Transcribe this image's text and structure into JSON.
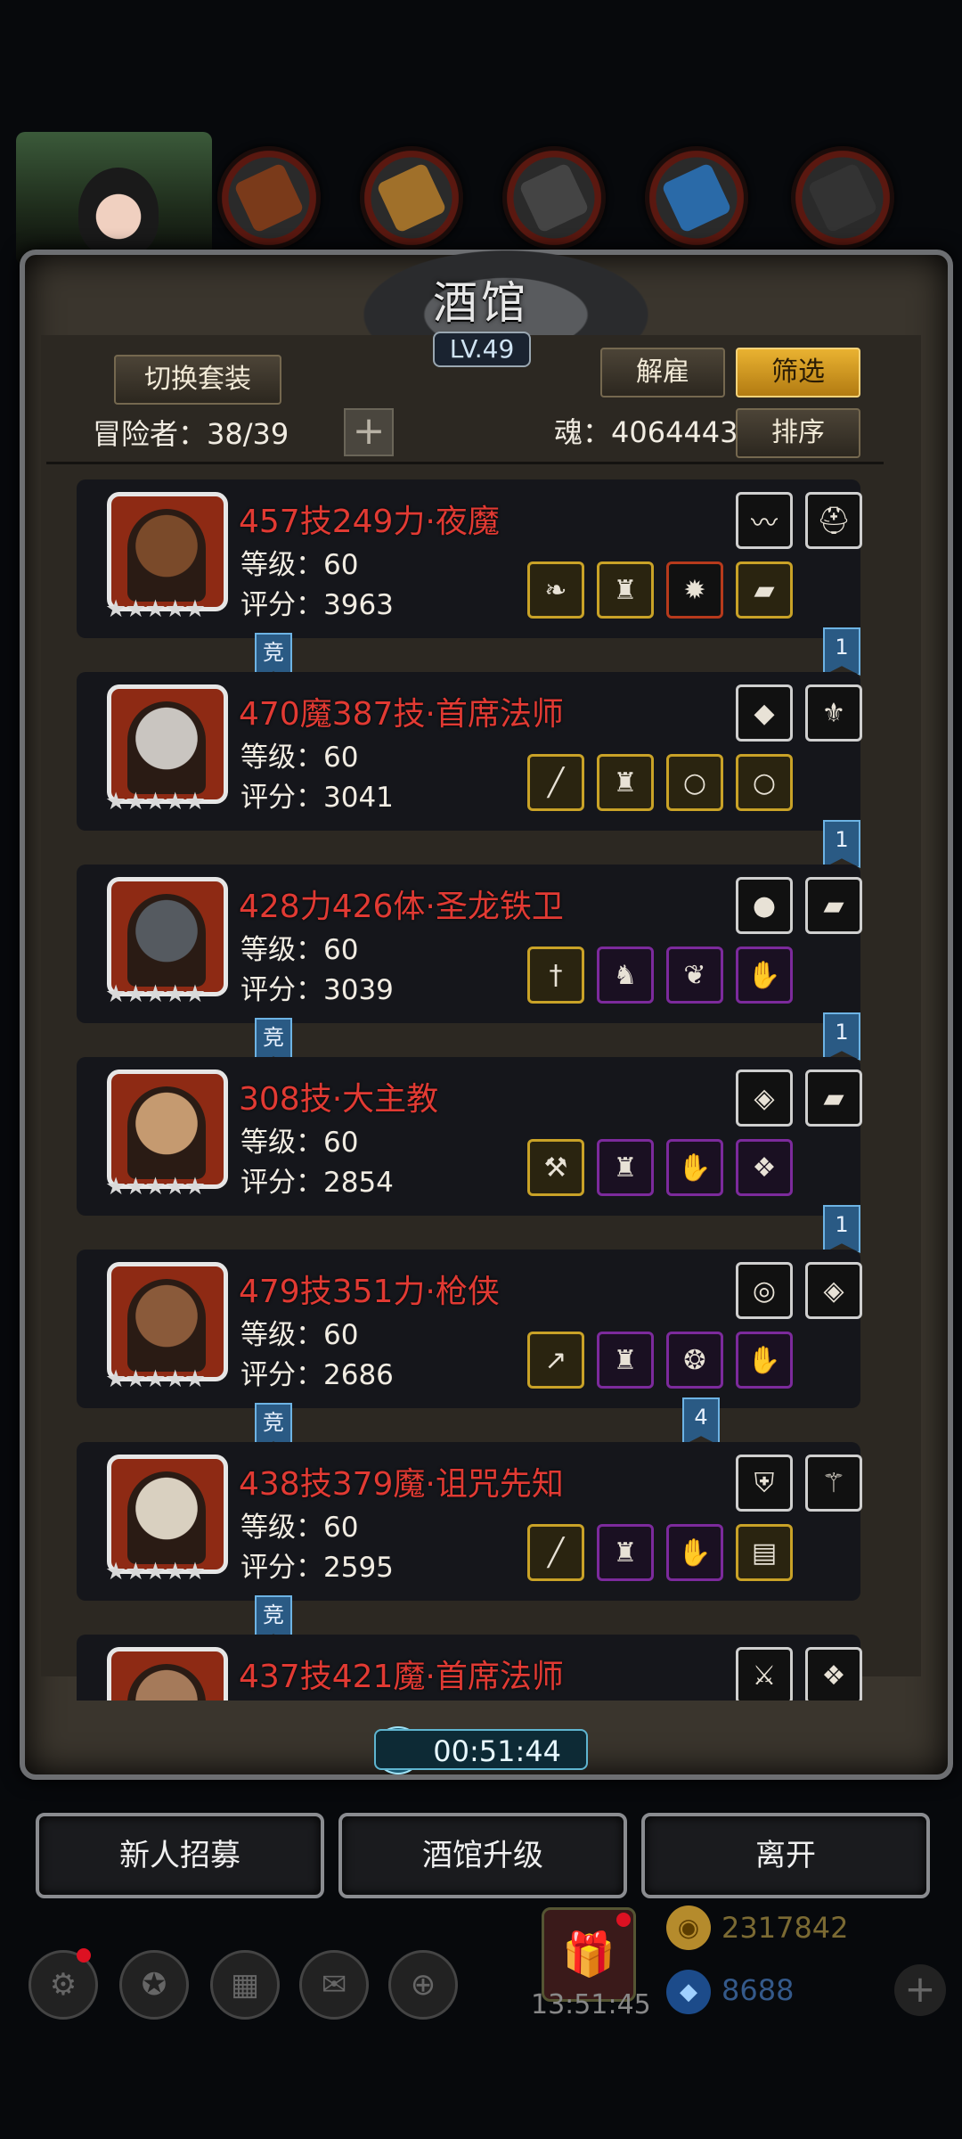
{
  "header": {
    "title": "酒馆",
    "level": "LV.49",
    "switch_label": "切换套装",
    "dismiss_label": "解雇",
    "filter_label": "筛选",
    "sort_label": "排序",
    "adventurers_label": "冒险者：38/39",
    "soul_label": "魂：4064443",
    "plus_symbol": "+"
  },
  "heroes": [
    {
      "name": "457技249力·夜魔",
      "level": "等级：60",
      "score": "评分：3963",
      "stars": "★★★★★",
      "badge": "竞",
      "tag": "1",
      "top_icons": [
        "whip-icon",
        "helmet-icon"
      ],
      "bottom_icons": [
        "blade-icon",
        "armor-icon",
        "amulet-icon",
        "bracer-icon"
      ]
    },
    {
      "name": "470魔387技·首席法师",
      "level": "等级：60",
      "score": "评分：3041",
      "stars": "★★★★★",
      "badge": "",
      "tag": "1",
      "top_icons": [
        "ruby-icon",
        "emblem-icon"
      ],
      "bottom_icons": [
        "staff-icon",
        "armor-icon",
        "ring-icon",
        "ring-icon"
      ]
    },
    {
      "name": "428力426体·圣龙铁卫",
      "level": "等级：60",
      "score": "评分：3039",
      "stars": "★★★★★",
      "badge": "竞",
      "tag": "1",
      "top_icons": [
        "fire-orb-icon",
        "bracer-icon"
      ],
      "bottom_icons": [
        "sword-icon",
        "chest-icon",
        "cloak-icon",
        "gauntlet-icon"
      ]
    },
    {
      "name": "308技·大主教",
      "level": "等级：60",
      "score": "评分：2854",
      "stars": "★★★★★",
      "badge": "",
      "tag": "1",
      "top_icons": [
        "gem-icon",
        "bracer-icon"
      ],
      "bottom_icons": [
        "hammer-icon",
        "armor-icon",
        "gauntlet-icon",
        "crystal-icon"
      ]
    },
    {
      "name": "479技351力·枪侠",
      "level": "等级：60",
      "score": "评分：2686",
      "stars": "★★★★★",
      "badge": "竞",
      "tag": "4",
      "top_icons": [
        "stone-icon",
        "gem-icon"
      ],
      "bottom_icons": [
        "spear-icon",
        "armor-icon",
        "necklace-icon",
        "gauntlet-icon"
      ]
    },
    {
      "name": "438技379魔·诅咒先知",
      "level": "等级：60",
      "score": "评分：2595",
      "stars": "★★★★★",
      "badge": "竞",
      "tag": "",
      "top_icons": [
        "shield-icon",
        "rod-icon"
      ],
      "bottom_icons": [
        "staff-icon",
        "armor-icon",
        "gauntlet-icon",
        "scroll-icon"
      ]
    },
    {
      "name": "437技421魔·首席法师",
      "level": "",
      "score": "",
      "stars": "",
      "badge": "",
      "tag": "",
      "top_icons": [
        "dagger-icon",
        "crystal-icon"
      ],
      "bottom_icons": []
    }
  ],
  "footer": {
    "timer": "00:51:44",
    "recruit_label": "新人招募",
    "upgrade_label": "酒馆升级",
    "leave_label": "离开",
    "gift_time": "13:51:45",
    "gold": "2317842",
    "gems": "8688"
  }
}
